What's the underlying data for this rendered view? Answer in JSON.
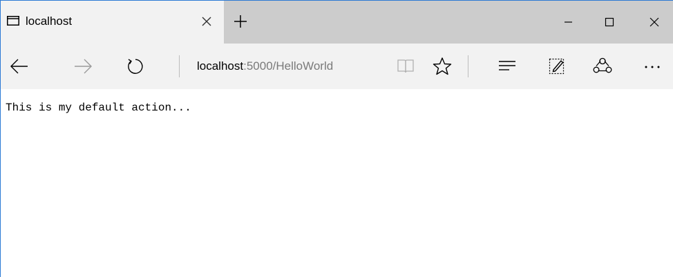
{
  "tab": {
    "title": "localhost",
    "icon": "tab-page-icon"
  },
  "window_controls": [
    "minimize-icon",
    "maximize-icon",
    "close-icon"
  ],
  "address_bar": {
    "host": "localhost",
    "rest": ":5000/HelloWorld"
  },
  "toolbar_icons": [
    "back-arrow-icon",
    "forward-arrow-icon",
    "refresh-icon",
    "reading-view-icon",
    "favorite-star-icon",
    "hub-icon",
    "web-note-icon",
    "share-icon",
    "more-icon"
  ],
  "page": {
    "body_text": "This is my default action..."
  },
  "colors": {
    "window_border": "#2b79d4",
    "tabstrip": "#cccccc",
    "chrome": "#f2f2f2",
    "address_muted": "#7a7a7a"
  }
}
